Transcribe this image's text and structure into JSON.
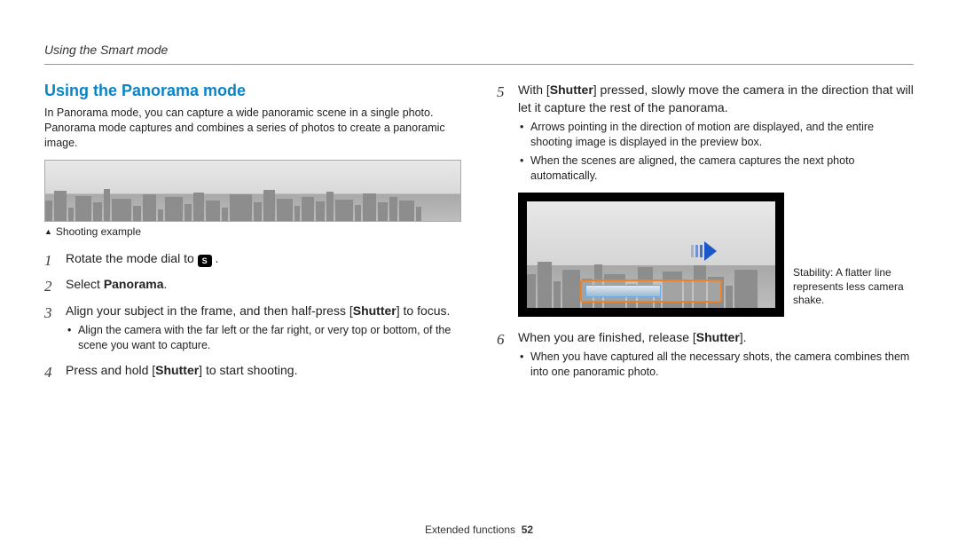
{
  "header": {
    "breadcrumb": "Using the Smart mode"
  },
  "left": {
    "title": "Using the Panorama mode",
    "intro": "In Panorama mode, you can capture a wide panoramic scene in a single photo. Panorama mode captures and combines a series of photos to create a panoramic image.",
    "example_label": "Shooting example",
    "steps": {
      "s1": {
        "num": "1",
        "pre": "Rotate the mode dial to ",
        "icon": "S",
        "post": " ."
      },
      "s2": {
        "num": "2",
        "pre": "Select ",
        "bold": "Panorama",
        "post": "."
      },
      "s3": {
        "num": "3",
        "pre": "Align your subject in the frame, and then half-press [",
        "bold": "Shutter",
        "post": "] to focus.",
        "sub1": "Align the camera with the far left or the far right, or very top or bottom, of the scene you want to capture."
      },
      "s4": {
        "num": "4",
        "pre": "Press and hold [",
        "bold": "Shutter",
        "post": "] to start shooting."
      }
    }
  },
  "right": {
    "s5": {
      "num": "5",
      "pre": "With [",
      "bold": "Shutter",
      "post": "] pressed, slowly move the camera in the direction that will let it capture the rest of the panorama.",
      "sub1": "Arrows pointing in the direction of motion are displayed, and the entire shooting image is displayed in the preview box.",
      "sub2": "When the scenes are aligned, the camera captures the next photo automatically."
    },
    "stability_note": "Stability: A flatter line represents less camera shake.",
    "s6": {
      "num": "6",
      "pre": "When you are finished, release [",
      "bold": "Shutter",
      "post": "].",
      "sub1": "When you have captured all the necessary shots, the camera combines them into one panoramic photo."
    }
  },
  "footer": {
    "section": "Extended functions",
    "page": "52"
  }
}
